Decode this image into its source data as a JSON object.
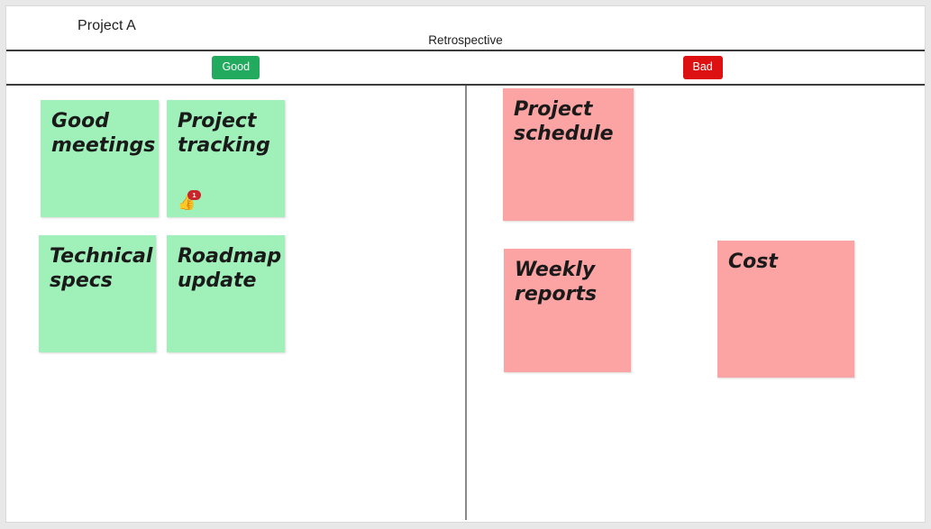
{
  "header": {
    "project_title": "Project A",
    "board_title": "Retrospective"
  },
  "columns": [
    {
      "id": "good",
      "label": "Good",
      "color": "#22aa5e"
    },
    {
      "id": "bad",
      "label": "Bad",
      "color": "#dd1111"
    }
  ],
  "notes": {
    "good": [
      {
        "text": "Good meetings",
        "color": "#9ff0b9",
        "reaction": null
      },
      {
        "text": "Project tracking",
        "color": "#9ff0b9",
        "reaction": {
          "icon": "thumbs-up-icon",
          "glyph": "👍",
          "count": "1"
        }
      },
      {
        "text": "Technical specs",
        "color": "#9ff0b9",
        "reaction": null
      },
      {
        "text": "Roadmap update",
        "color": "#9ff0b9",
        "reaction": null
      }
    ],
    "bad": [
      {
        "text": "Project schedule",
        "color": "#fca4a4",
        "reaction": null
      },
      {
        "text": "Weekly reports",
        "color": "#fca4a4",
        "reaction": null
      },
      {
        "text": "Cost",
        "color": "#fca4a4",
        "reaction": null
      }
    ]
  }
}
